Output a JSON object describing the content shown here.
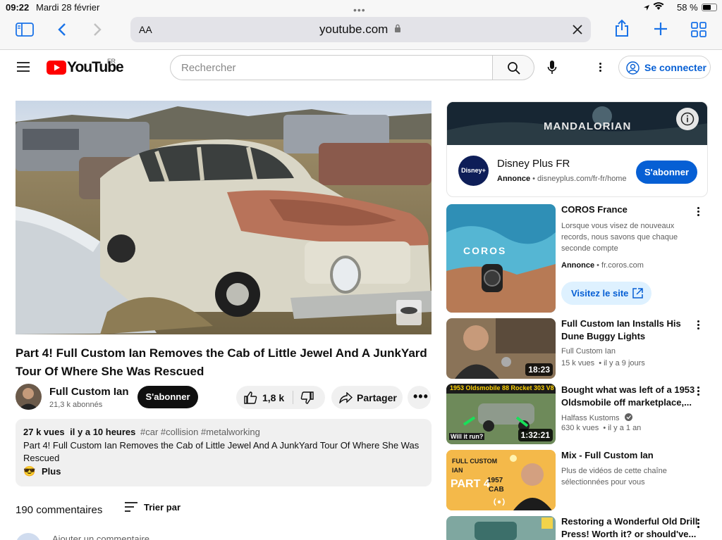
{
  "status": {
    "time": "09:22",
    "date": "Mardi 28 février",
    "battery": "58 %"
  },
  "safari": {
    "text_size": "AA",
    "url": "youtube.com"
  },
  "header": {
    "logo": "YouTube",
    "region": "FR",
    "search_placeholder": "Rechercher",
    "signin": "Se connecter"
  },
  "video": {
    "title_line1": "Part 4! Full Custom Ian Removes the Cab of Little Jewel And A JunkYard",
    "title_line2": "Tour Of Where She Was Rescued",
    "channel": "Full Custom Ian",
    "subscribers": "21,3 k abonnés",
    "subscribe": "S'abonner",
    "likes": "1,8 k",
    "share": "Partager"
  },
  "description": {
    "views": "27 k vues",
    "age": "il y a 10 heures",
    "tags": "#car #collision #metalworking",
    "text_line1": "Part 4! Full Custom Ian Removes the Cab of Little Jewel And A JunkYard Tour Of Where She Was",
    "text_line2": "Rescued",
    "more": "Plus"
  },
  "comments": {
    "count": "190 commentaires",
    "sort": "Trier par",
    "add": "Ajouter un commentaire"
  },
  "ad": {
    "banner": "MANDALORIAN",
    "name": "Disney Plus FR",
    "label": "Annonce",
    "url": "disneyplus.com/fr-fr/home",
    "cta": "S'abonner"
  },
  "sidebar": [
    {
      "title1": "COROS France",
      "title2": "",
      "d1": "Lorsque vous visez de nouveaux",
      "d2": "records, nous savons que chaque",
      "d3": "seconde compte",
      "ad_label": "Annonce",
      "ad_url": "fr.coros.com",
      "cta": "Visitez le site",
      "thumb_text": "COROS"
    },
    {
      "title1": "Full Custom Ian Installs His",
      "title2": "Dune Buggy Lights",
      "channel": "Full Custom Ian",
      "meta": "15 k vues  • il y a 9 jours",
      "duration": "18:23"
    },
    {
      "title1": "Bought what was left of a 1953",
      "title2": "Oldsmobile off marketplace,...",
      "channel": "Halfass Kustoms",
      "meta": "630 k vues  • il y a 1 an",
      "duration": "1:32:21",
      "thumb_text": "1953 Oldsmobile 88 Rocket 303 V8",
      "thumb_text2": "Will it run?"
    },
    {
      "title1": "Mix - Full Custom Ian",
      "title2": "",
      "d1": "Plus de vidéos de cette chaîne",
      "d2": "sélectionnées pour vous",
      "thumb_t1": "FULL CUSTOM",
      "thumb_t2": "IAN",
      "thumb_t3": "PART 4",
      "thumb_t4": "1957",
      "thumb_t5": "CAB"
    },
    {
      "title1": "Restoring a Wonderful Old Drill",
      "title2": "Press! Worth it? or should've..."
    }
  ],
  "colors": {
    "youtube_red": "#ff0000",
    "link_blue": "#065fd4",
    "safari_blue": "#1a73e8"
  }
}
